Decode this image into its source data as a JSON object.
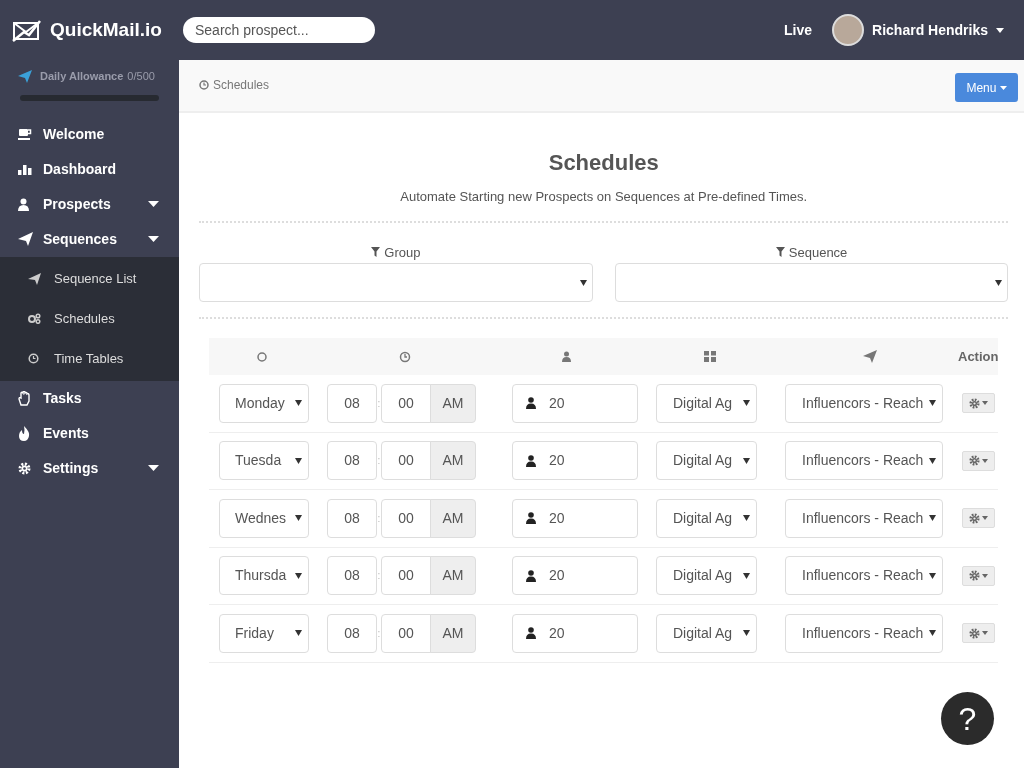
{
  "header": {
    "brand": "QuickMail.io",
    "search": {
      "placeholder": "Search prospect..."
    },
    "live": "Live",
    "user": "Richard Hendriks"
  },
  "sidebar": {
    "allowance": {
      "label": "Daily Allowance",
      "count": "0/500",
      "level": 0
    },
    "items": [
      {
        "label": "Welcome",
        "dropdown": false
      },
      {
        "label": "Dashboard",
        "dropdown": false
      },
      {
        "label": "Prospects",
        "dropdown": true
      },
      {
        "label": "Sequences",
        "dropdown": true,
        "expanded": true,
        "children": [
          {
            "label": "Sequence List"
          },
          {
            "label": "Schedules"
          },
          {
            "label": "Time Tables"
          }
        ]
      },
      {
        "label": "Tasks",
        "dropdown": false
      },
      {
        "label": "Events",
        "dropdown": false
      },
      {
        "label": "Settings",
        "dropdown": true
      }
    ]
  },
  "breadcrumb": "Schedules",
  "menu_button": "Menu",
  "title": "Schedules",
  "subtitle": "Automate Starting new Prospects on Sequences at Pre-defined Times.",
  "filters": [
    {
      "label": "Group"
    },
    {
      "label": "Sequence"
    }
  ],
  "table": {
    "action_header": "Action",
    "rows": [
      {
        "day": "Monday",
        "hour": "08",
        "separator": ":",
        "minute": "00",
        "ampm": "AM",
        "count": "20",
        "group": "Digital Ag",
        "sequence": "Influencors - Reach"
      },
      {
        "day": "Tuesda",
        "hour": "08",
        "separator": ":",
        "minute": "00",
        "ampm": "AM",
        "count": "20",
        "group": "Digital Ag",
        "sequence": "Influencors - Reach"
      },
      {
        "day": "Wednes",
        "hour": "08",
        "separator": ":",
        "minute": "00",
        "ampm": "AM",
        "count": "20",
        "group": "Digital Ag",
        "sequence": "Influencors - Reach"
      },
      {
        "day": "Thursda",
        "hour": "08",
        "separator": ":",
        "minute": "00",
        "ampm": "AM",
        "count": "20",
        "group": "Digital Ag",
        "sequence": "Influencors - Reach"
      },
      {
        "day": "Friday",
        "hour": "08",
        "separator": ":",
        "minute": "00",
        "ampm": "AM",
        "count": "20",
        "group": "Digital Ag",
        "sequence": "Influencors - Reach"
      }
    ]
  },
  "help_button": "?"
}
